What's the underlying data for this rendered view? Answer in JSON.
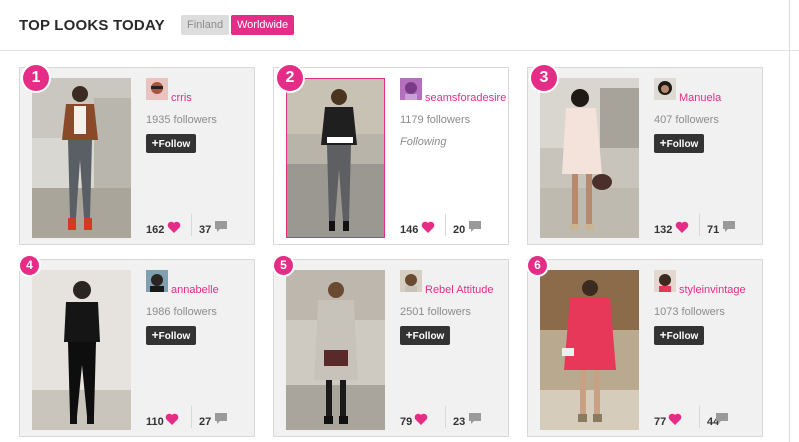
{
  "header": {
    "title": "TOP LOOKS TODAY",
    "tabs": [
      {
        "label": "Finland",
        "active": false
      },
      {
        "label": "Worldwide",
        "active": true
      }
    ]
  },
  "colors": {
    "accent": "#e52d87",
    "follow_button": "#333333",
    "card_bg": "#f1f1f1"
  },
  "looks": [
    {
      "rank": "1",
      "username": "crris",
      "followers": "1935 followers",
      "action": "Follow",
      "likes": "162",
      "comments": "37"
    },
    {
      "rank": "2",
      "username": "seamsforadesire",
      "followers": "1179 followers",
      "action": "Following",
      "likes": "146",
      "comments": "20"
    },
    {
      "rank": "3",
      "username": "Manuela",
      "followers": "407 followers",
      "action": "Follow",
      "likes": "132",
      "comments": "71"
    },
    {
      "rank": "4",
      "username": "annabelle",
      "followers": "1986 followers",
      "action": "Follow",
      "likes": "110",
      "comments": "27"
    },
    {
      "rank": "5",
      "username": "Rebel Attitude",
      "followers": "2501 followers",
      "action": "Follow",
      "likes": "79",
      "comments": "23"
    },
    {
      "rank": "6",
      "username": "styleinvintage",
      "followers": "1073 followers",
      "action": "Follow",
      "likes": "77",
      "comments": "44"
    }
  ]
}
